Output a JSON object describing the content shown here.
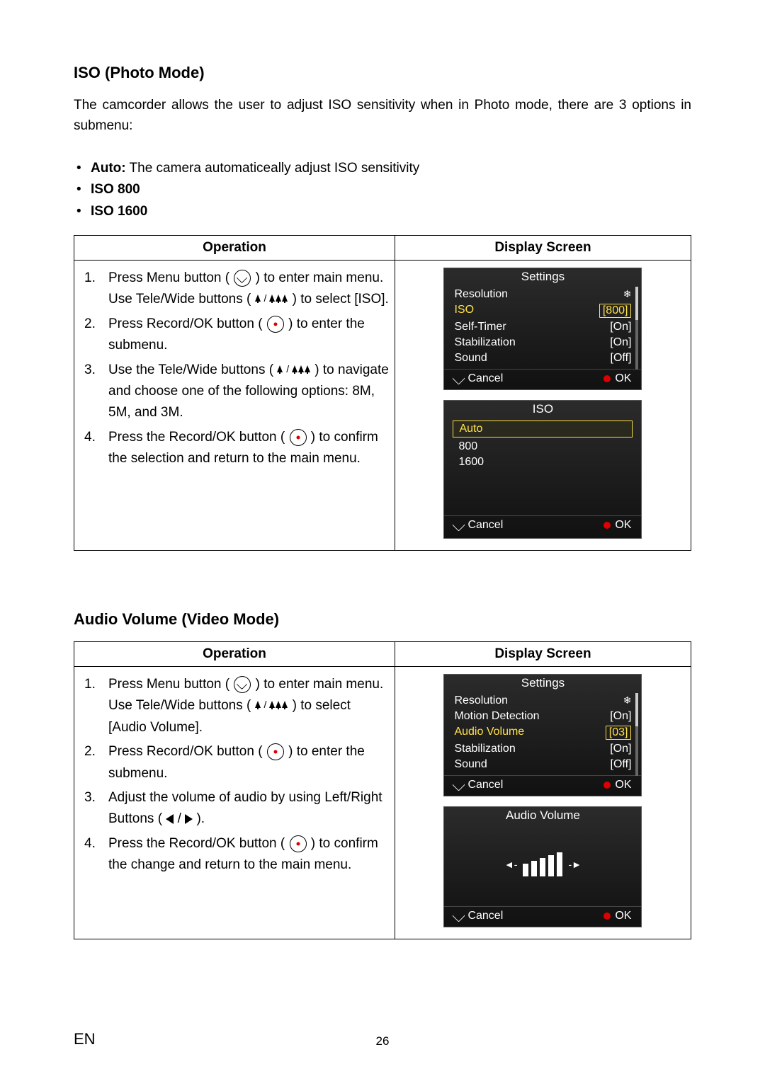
{
  "section1": {
    "heading": "ISO (Photo Mode)",
    "intro": "The camcorder allows the user to adjust ISO sensitivity when in Photo mode, there are 3 options in submenu:",
    "bullets": [
      {
        "bold": "Auto:",
        "rest": " The camera automaticeally adjust ISO sensitivity"
      },
      {
        "bold": "ISO 800",
        "rest": ""
      },
      {
        "bold": "ISO 1600",
        "rest": ""
      }
    ],
    "table": {
      "h1": "Operation",
      "h2": "Display Screen",
      "steps": {
        "s1a": "Press Menu button ( ",
        "s1b": " ) to enter main menu. Use Tele/Wide buttons ( ",
        "s1c": " ) to select [ISO].",
        "s2a": "Press Record/OK button ( ",
        "s2b": " ) to enter the submenu.",
        "s3a": "Use the Tele/Wide buttons ( ",
        "s3b": " ) to navigate and choose one of the following options: 8M, 5M, and 3M.",
        "s4a": "Press the Record/OK button ( ",
        "s4b": " ) to confirm the selection and return to the main menu."
      }
    },
    "lcd1": {
      "title": "Settings",
      "rows": [
        {
          "l": "Resolution",
          "v": "",
          "snow": true
        },
        {
          "l": "ISO",
          "v": "[800]",
          "sel": true
        },
        {
          "l": "Self-Timer",
          "v": "[On]"
        },
        {
          "l": "Stabilization",
          "v": "[On]"
        },
        {
          "l": "Sound",
          "v": "[Off]"
        }
      ],
      "cancel": "Cancel",
      "ok": "OK"
    },
    "lcd2": {
      "title": "ISO",
      "hl": "Auto",
      "opts": [
        "800",
        "1600"
      ],
      "cancel": "Cancel",
      "ok": "OK"
    }
  },
  "section2": {
    "heading": "Audio Volume (Video Mode)",
    "table": {
      "h1": "Operation",
      "h2": "Display Screen",
      "steps": {
        "s1a": "Press Menu button ( ",
        "s1b": " ) to enter main menu. Use Tele/Wide buttons ( ",
        "s1c": " ) to select [Audio Volume].",
        "s2a": "Press Record/OK button ( ",
        "s2b": " ) to enter the submenu.",
        "s3a": "Adjust the volume  of audio by using Left/Right Buttons ( ",
        "s3b": " ).",
        "s4a": "Press the Record/OK button ( ",
        "s4b": " ) to confirm the change and return to the main menu."
      }
    },
    "lcd1": {
      "title": "Settings",
      "rows": [
        {
          "l": "Resolution",
          "v": "",
          "snow": true
        },
        {
          "l": "Motion Detection",
          "v": "[On]"
        },
        {
          "l": "Audio Volume",
          "v": "[03]",
          "sel": true
        },
        {
          "l": "Stabilization",
          "v": "[On]"
        },
        {
          "l": "Sound",
          "v": "[Off]"
        }
      ],
      "cancel": "Cancel",
      "ok": "OK"
    },
    "lcd2": {
      "title": "Audio Volume",
      "cancel": "Cancel",
      "ok": "OK"
    }
  },
  "footer": {
    "lang": "EN",
    "page": "26"
  }
}
